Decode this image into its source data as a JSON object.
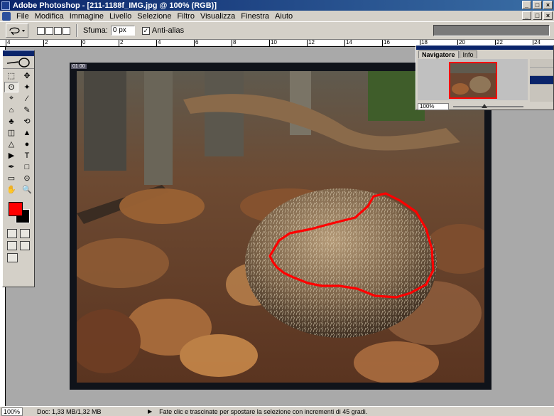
{
  "window": {
    "title": "Adobe Photoshop - [211-1188f_IMG.jpg @ 100% (RGB)]",
    "buttons": [
      "_",
      "□",
      "×"
    ]
  },
  "menu": {
    "items": [
      "File",
      "Modifica",
      "Immagine",
      "Livello",
      "Selezione",
      "Filtro",
      "Visualizza",
      "Finestra",
      "Aiuto"
    ],
    "doc_buttons": [
      "_",
      "□",
      "×"
    ]
  },
  "options": {
    "feather_label": "Sfuma:",
    "feather_value": "0 px",
    "antialias_label": "Anti-alias",
    "antialias_checked": "✓"
  },
  "ruler": {
    "ticks": [
      "4",
      "2",
      "0",
      "2",
      "4",
      "6",
      "8",
      "10",
      "12",
      "14",
      "16",
      "18",
      "20",
      "22",
      "24"
    ]
  },
  "toolbox": {
    "tools": [
      "⬚",
      "✥",
      "ʘ",
      "✦",
      "⌖",
      "⁄",
      "⌂",
      "✎",
      "♣",
      "⟲",
      "◫",
      "▲",
      "△",
      "●",
      "▶",
      "T",
      "✒",
      "□",
      "▭",
      "⊙",
      "✋",
      "🔍"
    ],
    "foreground_color": "#ff0000",
    "background_color": "#000000"
  },
  "navigator": {
    "tabs": [
      "Navigatore",
      "Info"
    ],
    "zoom": "100%"
  },
  "document": {
    "label": "01 00"
  },
  "status": {
    "zoom": "100%",
    "doc_size": "Doc: 1,33 MB/1,32 MB",
    "arrow": "▶",
    "hint": "Fate clic e trascinate per spostare la selezione con incrementi di 45 gradi."
  },
  "colors": {
    "selection": "#ff0000",
    "titlebar": "#0a246a"
  }
}
